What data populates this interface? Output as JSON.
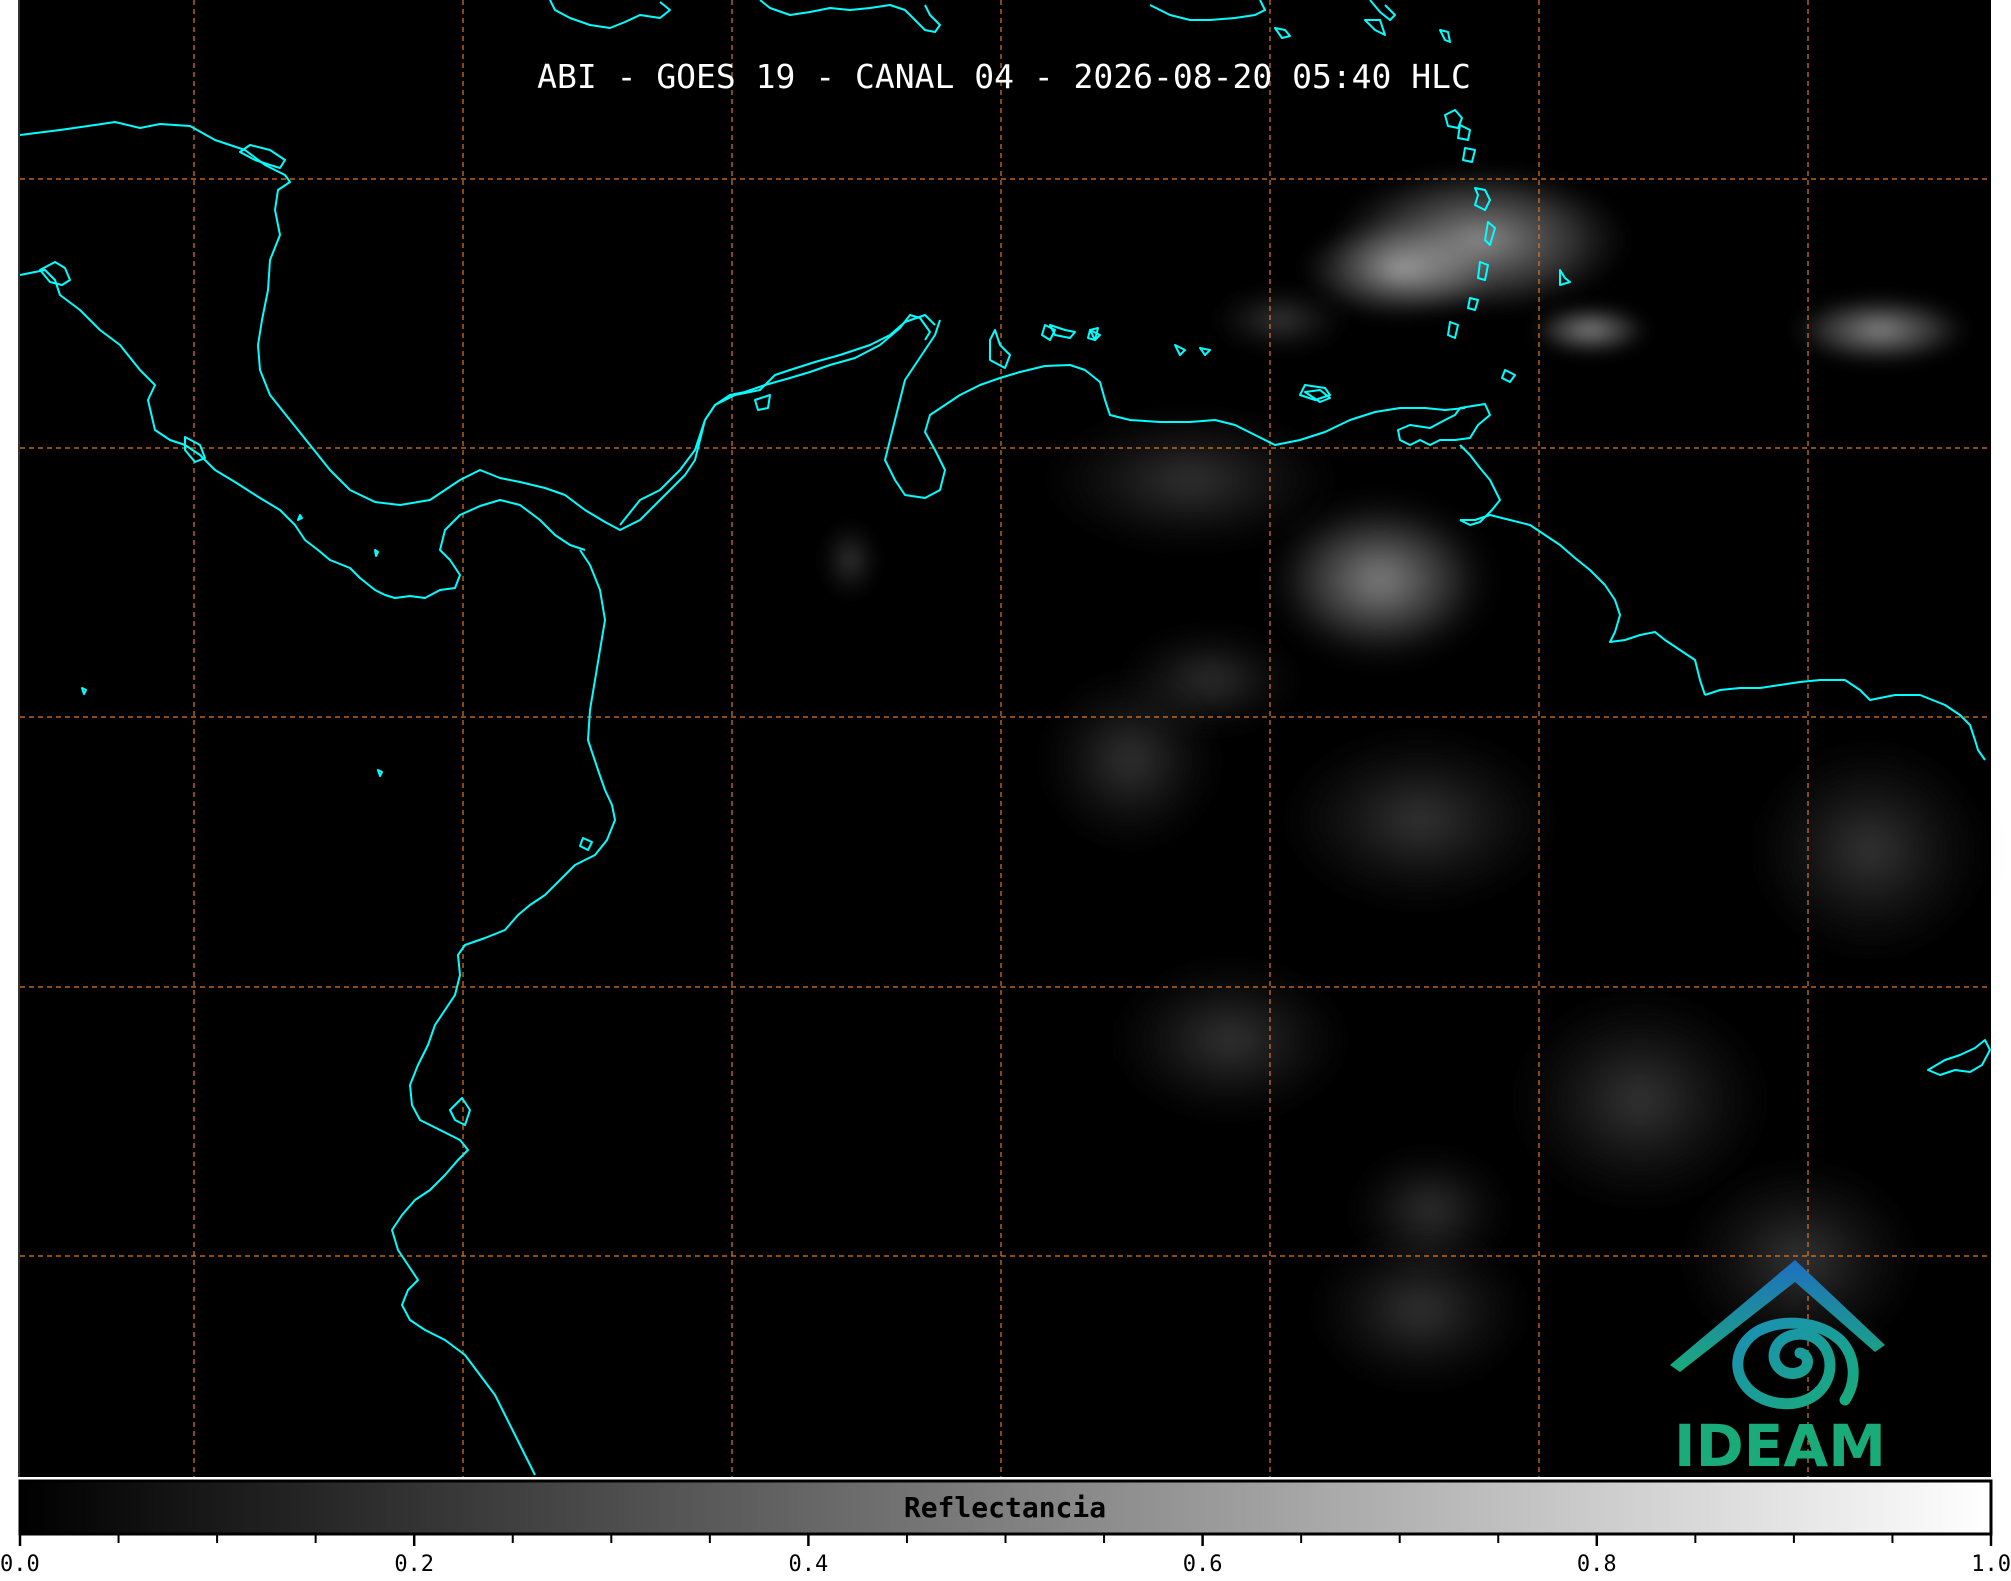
{
  "map": {
    "title": "ABI - GOES 19 - CANAL 04 - 2026-08-20 05:40 HLC",
    "background_color": "#000000",
    "coastline_color": "#00ffff",
    "gridline_color": "#e07820",
    "gridline_style": "dashed"
  },
  "logo": {
    "text": "IDEAM",
    "text_color": "#1aab7a",
    "roof_color": "#1f6fc0",
    "swirl_color": "#1a9e8e",
    "icon": "ideam-logo-icon"
  },
  "colorbar": {
    "label": "Reflectancia",
    "min": 0.0,
    "max": 1.0,
    "tick_labels": [
      "0.0",
      "0.2",
      "0.4",
      "0.6",
      "0.8",
      "1.0"
    ],
    "minor_tick_step": 0.05,
    "color_start": "#000000",
    "color_end": "#ffffff"
  }
}
